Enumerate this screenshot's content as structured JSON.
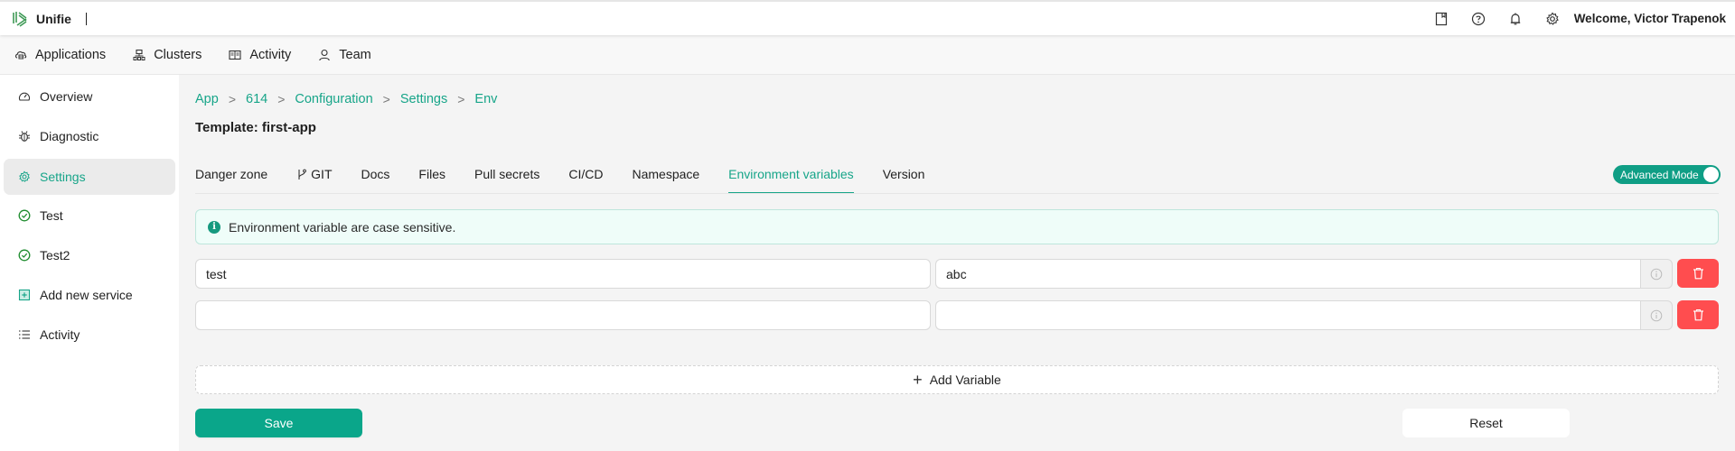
{
  "header": {
    "brand": "Unifie",
    "welcome": "Welcome, Victor Trapenok",
    "icons": [
      "book-icon",
      "help-icon",
      "bell-icon",
      "gear-icon"
    ]
  },
  "nav": {
    "items": [
      {
        "label": "Applications",
        "icon": "cloud-app-icon"
      },
      {
        "label": "Clusters",
        "icon": "cluster-icon"
      },
      {
        "label": "Activity",
        "icon": "book-open-icon"
      },
      {
        "label": "Team",
        "icon": "user-icon"
      }
    ]
  },
  "sidebar": {
    "items": [
      {
        "label": "Overview",
        "icon": "dashboard-icon"
      },
      {
        "label": "Diagnostic",
        "icon": "bug-icon"
      },
      {
        "label": "Settings",
        "icon": "gear-icon",
        "active": true
      },
      {
        "label": "Test",
        "icon": "check-circle-icon"
      },
      {
        "label": "Test2",
        "icon": "check-circle-icon"
      },
      {
        "label": "Add new service",
        "icon": "plus-square-icon"
      },
      {
        "label": "Activity",
        "icon": "list-icon"
      }
    ]
  },
  "breadcrumb": [
    "App",
    "614",
    "Configuration",
    "Settings",
    "Env"
  ],
  "breadcrumb_separator": ">",
  "page_title": "Template: first-app",
  "tabs": [
    {
      "label": "Danger zone"
    },
    {
      "label": "GIT",
      "icon": "git-branch-icon"
    },
    {
      "label": "Docs"
    },
    {
      "label": "Files"
    },
    {
      "label": "Pull secrets"
    },
    {
      "label": "CI/CD"
    },
    {
      "label": "Namespace"
    },
    {
      "label": "Environment variables",
      "active": true
    },
    {
      "label": "Version"
    }
  ],
  "advanced_mode": {
    "label": "Advanced Mode",
    "enabled": true
  },
  "alert": {
    "text": "Environment variable are case sensitive.",
    "icon": "info-icon"
  },
  "env_vars": [
    {
      "key": "test",
      "value": "abc"
    },
    {
      "key": "",
      "value": ""
    }
  ],
  "add_variable_label": "Add Variable",
  "save_label": "Save",
  "reset_label": "Reset",
  "colors": {
    "accent": "#17a589",
    "primary_button": "#0aa68a",
    "danger": "#ff4d4f",
    "alert_bg": "#effdf9"
  }
}
